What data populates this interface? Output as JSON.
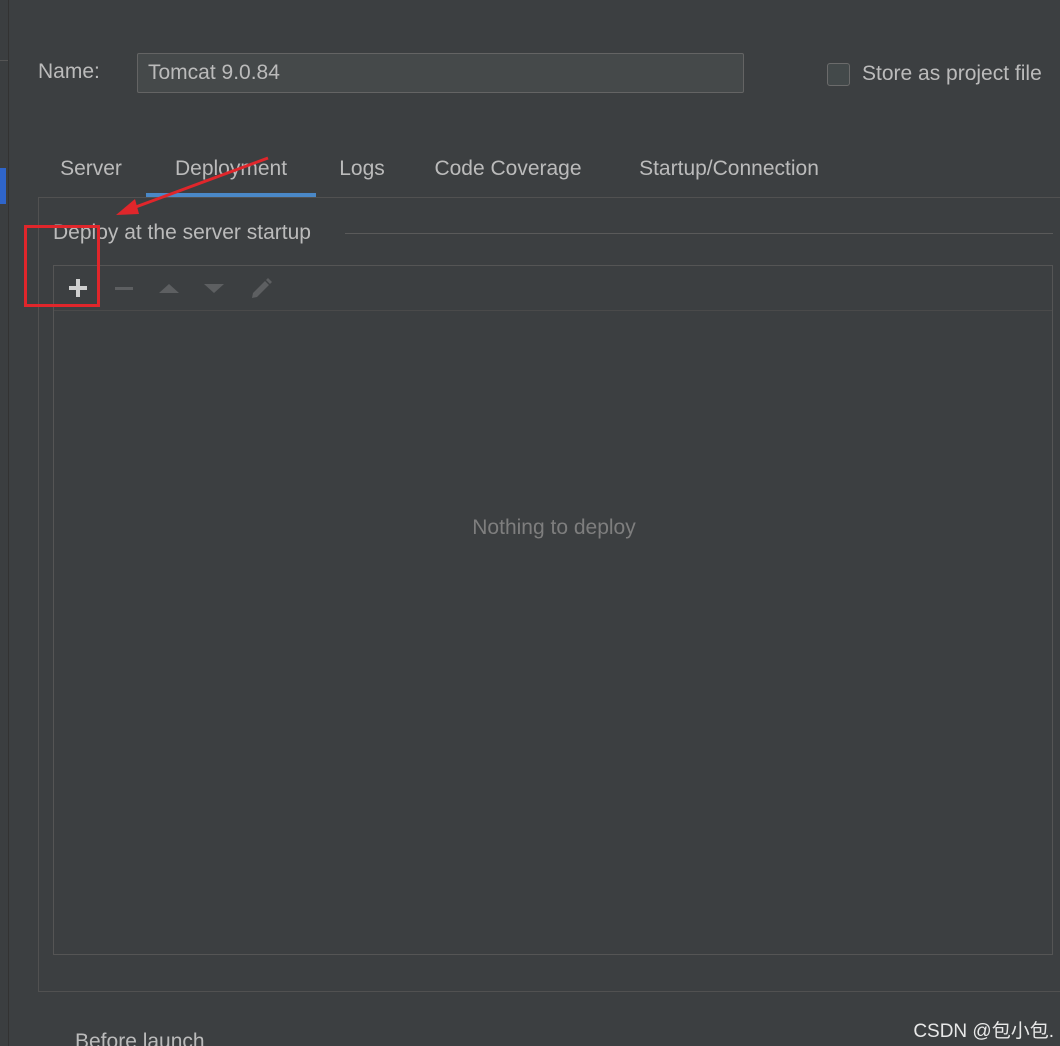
{
  "form": {
    "name_label": "Name:",
    "name_value": "Tomcat 9.0.84",
    "store_label": "Store as project file",
    "store_checked": false
  },
  "tabs": [
    {
      "label": "Server",
      "active": false
    },
    {
      "label": "Deployment",
      "active": true
    },
    {
      "label": "Logs",
      "active": false
    },
    {
      "label": "Code Coverage",
      "active": false
    },
    {
      "label": "Startup/Connection",
      "active": false
    }
  ],
  "deploy": {
    "section_title": "Deploy at the server startup",
    "toolbar": [
      {
        "icon": "plus-icon",
        "enabled": true
      },
      {
        "icon": "minus-icon",
        "enabled": false
      },
      {
        "icon": "arrow-up-icon",
        "enabled": false
      },
      {
        "icon": "arrow-down-icon",
        "enabled": false
      },
      {
        "icon": "pencil-icon",
        "enabled": false
      }
    ],
    "empty_text": "Nothing to deploy"
  },
  "bottom_partial_text": "Before launch",
  "watermark": "CSDN @包小包.",
  "colors": {
    "background": "#3c3f41",
    "accent_tab": "#4a88c7",
    "annotation": "#e0262b"
  }
}
